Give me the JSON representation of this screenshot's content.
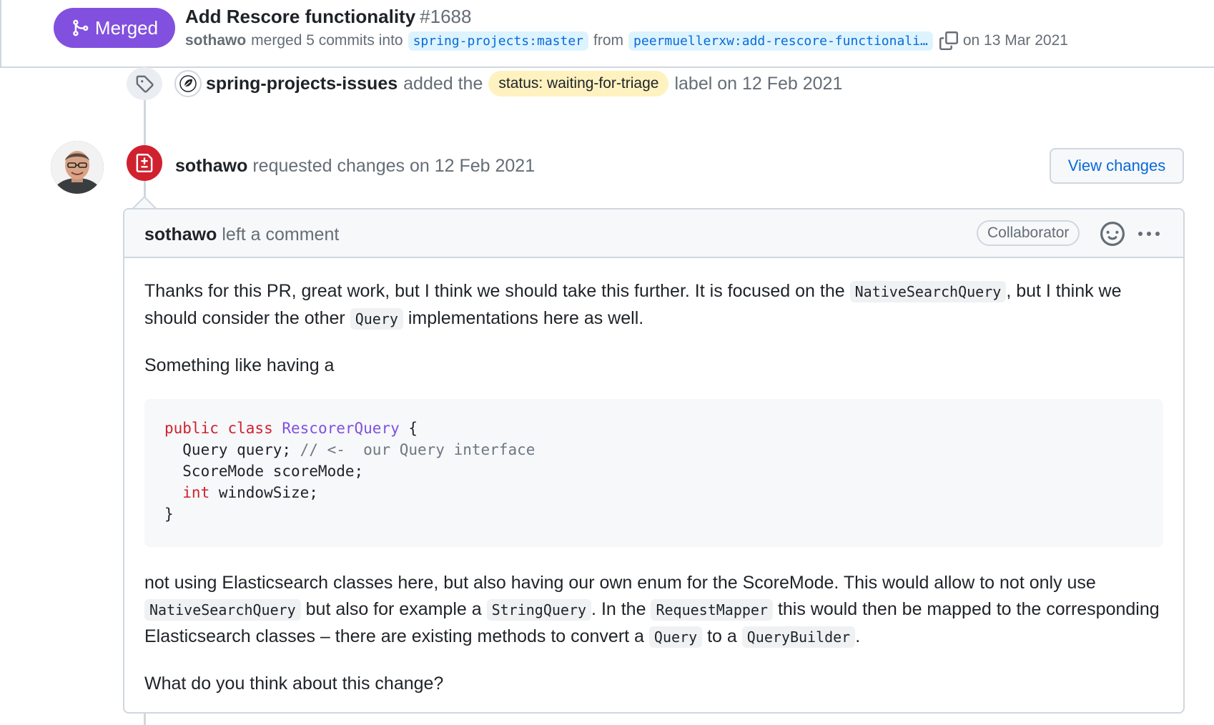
{
  "header": {
    "state_badge": "Merged",
    "title": "Add Rescore functionality",
    "number": "#1688",
    "meta_author": "sothawo",
    "meta_action": "merged 5 commits into",
    "base_branch": "spring-projects:master",
    "meta_from": "from",
    "head_branch": "peermuellerxw:add-rescore-functionali…",
    "meta_date": "on 13 Mar 2021"
  },
  "label_event": {
    "actor": "spring-projects-issues",
    "action": "added the",
    "label": "status: waiting-for-triage",
    "suffix": "label on 12 Feb 2021"
  },
  "review_event": {
    "actor": "sothawo",
    "action": "requested changes on 12 Feb 2021",
    "view_changes_label": "View changes"
  },
  "comment": {
    "author": "sothawo",
    "action": "left a comment",
    "badge": "Collaborator",
    "p1_a": "Thanks for this PR, great work, but I think we should take this further. It is focused on the",
    "p1_code1": "NativeSearchQuery",
    "p1_b": ", but I think we should consider the other",
    "p1_code2": "Query",
    "p1_c": "implementations here as well.",
    "p2": "Something like having a",
    "code": {
      "l1_kw": "public class",
      "l1_cls": "RescorerQuery",
      "l1_rest": " {",
      "l2": "  Query query;",
      "l2_cmt": " // <-  our Query interface",
      "l3": "  ScoreMode scoreMode;",
      "l4_kw": "  int",
      "l4_rest": " windowSize;",
      "l5": "}"
    },
    "p3_a": "not using Elasticsearch classes here, but also having our own enum for the ScoreMode. This would allow to not only use",
    "p3_code1": "NativeSearchQuery",
    "p3_b": "but also for example a",
    "p3_code2": "StringQuery",
    "p3_c": ". In the",
    "p3_code3": "RequestMapper",
    "p3_d": "this would then be mapped to the corresponding Elasticsearch classes – there are existing methods to convert a",
    "p3_code4": "Query",
    "p3_e": "to a",
    "p3_code5": "QueryBuilder",
    "p3_f": ".",
    "p4": "What do you think about this change?"
  },
  "colors": {
    "merged": "#8250df",
    "changes_requested": "#cf222e",
    "link": "#0969da",
    "label_bg": "#fef2c0"
  }
}
